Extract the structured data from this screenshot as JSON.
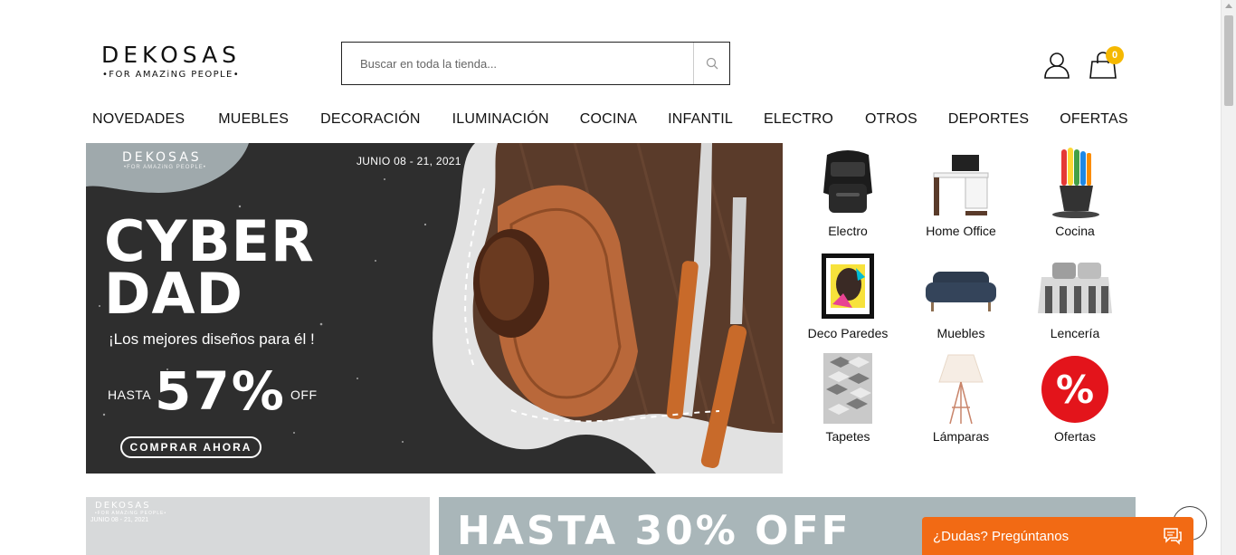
{
  "header": {
    "logo_name": "DEKOSAS",
    "logo_tagline": "•FOR AMAZiNG PEOPLE•",
    "search_placeholder": "Buscar en toda la tienda...",
    "cart_count": "0"
  },
  "nav": {
    "items": [
      "NOVEDADES",
      "MUEBLES",
      "DECORACIÓN",
      "ILUMINACIÓN",
      "COCINA",
      "INFANTIL",
      "ELECTRO",
      "OTROS",
      "DEPORTES",
      "OFERTAS"
    ]
  },
  "hero": {
    "brand": "DEKOSAS",
    "brand_sub": "•FOR AMAZiNG PEOPLE•",
    "date": "JUNIO 08 - 21, 2021",
    "title": "CYBER\nDAD",
    "subtitle": "¡Los mejores diseños para él !",
    "hasta": "HASTA",
    "percent": "57%",
    "off": "OFF",
    "cta": "COMPRAR AHORA"
  },
  "categories": [
    {
      "label": "Electro",
      "icon": "air-fryer-icon"
    },
    {
      "label": "Home Office",
      "icon": "desk-icon"
    },
    {
      "label": "Cocina",
      "icon": "kitchen-utensils-icon"
    },
    {
      "label": "Deco Paredes",
      "icon": "wall-art-icon"
    },
    {
      "label": "Muebles",
      "icon": "sofa-icon"
    },
    {
      "label": "Lencería",
      "icon": "bed-linen-icon"
    },
    {
      "label": "Tapetes",
      "icon": "rug-icon"
    },
    {
      "label": "Lámparas",
      "icon": "lamp-icon"
    },
    {
      "label": "Ofertas",
      "icon": "percent-icon"
    }
  ],
  "banners": {
    "left_brand": "DEKOSAS",
    "left_sub": "•FOR AMAZiNG PEOPLE•",
    "left_date": "JUNIO 08 - 21, 2021",
    "right_text": "HASTA 30% OFF"
  },
  "chat": {
    "label": "¿Dudas? Pregúntanos"
  },
  "colors": {
    "accent_orange": "#f26a14",
    "badge_yellow": "#f5b800",
    "offer_red": "#e3141b"
  }
}
